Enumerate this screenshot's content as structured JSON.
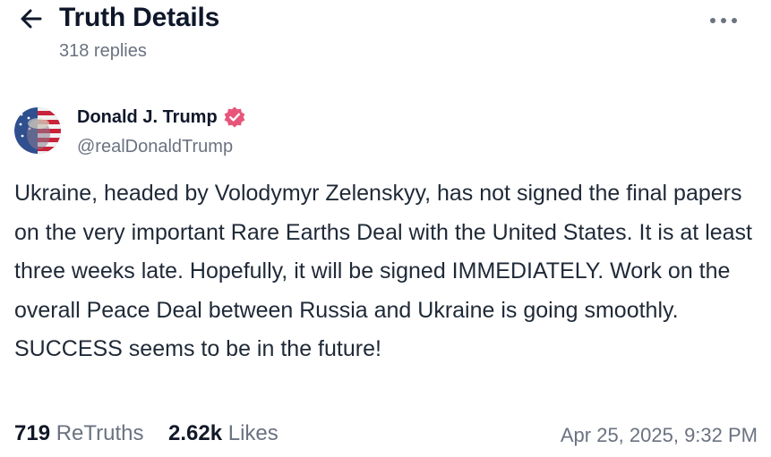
{
  "header": {
    "title": "Truth Details",
    "replies_count": "318 replies",
    "back_icon": "arrow-left-icon",
    "more_icon": "more-horizontal-icon"
  },
  "post": {
    "author": {
      "name": "Donald J. Trump",
      "handle": "@realDonaldTrump",
      "verified": true,
      "verified_icon": "verified-badge-icon",
      "verified_color": "#e8547a"
    },
    "text": "Ukraine, headed by Volodymyr Zelenskyy, has not signed the final papers on the very important Rare Earths Deal with the United States. It is at least three weeks late. Hopefully, it will be signed IMMEDIATELY. Work on the overall Peace Deal between Russia and Ukraine is going smoothly. SUCCESS seems to be in the future!",
    "stats": {
      "retruths_count": "719",
      "retruths_label": "ReTruths",
      "likes_count": "2.62k",
      "likes_label": "Likes"
    },
    "timestamp": "Apr 25, 2025, 9:32 PM"
  },
  "colors": {
    "text_primary": "#0f172a",
    "text_secondary": "#6b7280",
    "badge": "#e8547a"
  }
}
